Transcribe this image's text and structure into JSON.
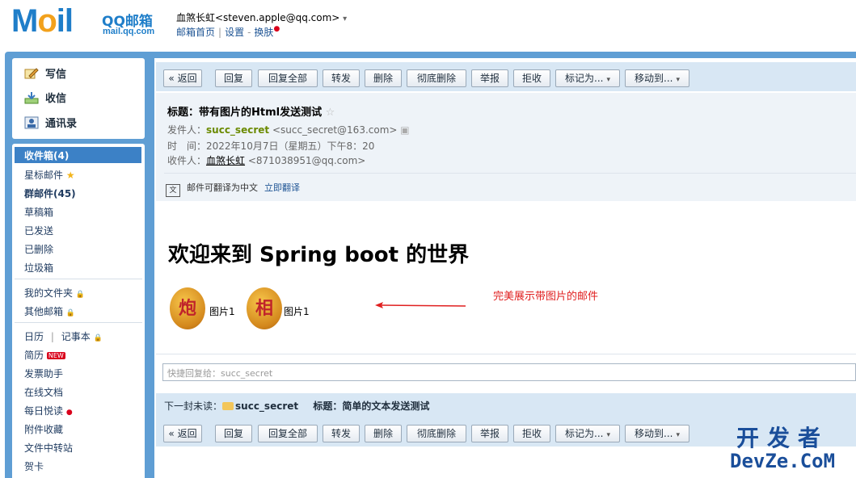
{
  "header": {
    "logo_text_before": "M",
    "logo_text_o": "o",
    "logo_text_after": "il",
    "logo_brand": "QQ邮箱",
    "logo_domain": "mail.qq.com",
    "user_display": "血煞长虹<steven.apple@qq.com>",
    "user_caret": "▾",
    "links": {
      "home": "邮箱首页",
      "settings": "设置",
      "dash": "-",
      "skin": "换肤",
      "skin_dot": "●"
    }
  },
  "sidebar": {
    "actions": [
      {
        "label": "写信",
        "icon": "pencil-icon"
      },
      {
        "label": "收信",
        "icon": "inbox-download-icon"
      },
      {
        "label": "通讯录",
        "icon": "contacts-icon"
      }
    ],
    "inbox": "收件箱(4)",
    "folders": [
      {
        "label": "星标邮件"
      },
      {
        "label": "群邮件(45)"
      },
      {
        "label": "草稿箱"
      },
      {
        "label": "已发送"
      },
      {
        "label": "已删除"
      },
      {
        "label": "垃圾箱"
      }
    ],
    "folders2": [
      {
        "label": "我的文件夹"
      },
      {
        "label": "其他邮箱"
      }
    ],
    "calendar": "日历",
    "notes": "记事本",
    "tools": [
      {
        "label": "简历",
        "badge": "NEW"
      },
      {
        "label": "发票助手"
      },
      {
        "label": "在线文档"
      },
      {
        "label": "每日悦读"
      },
      {
        "label": "附件收藏"
      },
      {
        "label": "文件中转站"
      },
      {
        "label": "贺卡"
      }
    ],
    "star_symbol": "★",
    "lock_symbol": "🔒"
  },
  "toolbar": {
    "buttons": [
      {
        "label": "« 返回"
      },
      {
        "label": "回复"
      },
      {
        "label": "回复全部"
      },
      {
        "label": "转发"
      },
      {
        "label": "删除"
      },
      {
        "label": "彻底删除"
      },
      {
        "label": "举报"
      },
      {
        "label": "拒收"
      },
      {
        "label": "标记为..."
      },
      {
        "label": "移动到..."
      }
    ],
    "dropdown_caret": "▾"
  },
  "mail": {
    "subject_label": "标题：",
    "subject": "带有图片的Html发送测试",
    "subject_star": "☆",
    "from_label": "发件人：",
    "from_name": "succ_secret",
    "from_addr": "<succ_secret@163.com>",
    "time_label": "时　间：",
    "time": "2022年10月7日（星期五）下午8：20",
    "to_label": "收件人：",
    "to_name": "血煞长虹",
    "to_addr": "<871038951@qq.com>",
    "translate_text": "邮件可翻译为中文",
    "translate_link": "立即翻译",
    "body_title": "欢迎来到 Spring boot 的世界",
    "images": [
      {
        "glyph": "炮",
        "label": "图片1"
      },
      {
        "glyph": "相",
        "label": "图片1"
      }
    ],
    "annotation": "完美展示带图片的邮件"
  },
  "quick_reply": {
    "placeholder": "快捷回复给：succ_secret"
  },
  "next_unread": {
    "label": "下一封未读：",
    "sender": "succ_secret",
    "subject_label": "标题：",
    "subject": "简单的文本发送测试"
  },
  "watermark": {
    "line1": "开发者",
    "line2": "DevZe.CoM"
  }
}
